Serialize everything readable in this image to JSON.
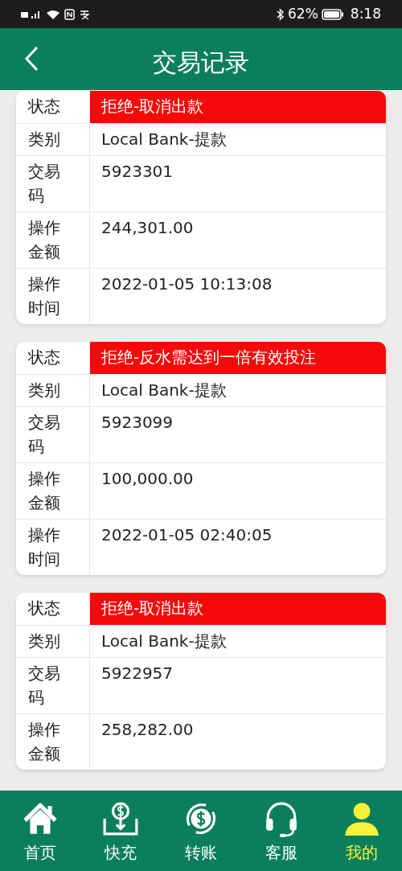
{
  "status_bar": {
    "battery_percent": "62%",
    "time": "8:18"
  },
  "header": {
    "title": "交易记录"
  },
  "records": [
    {
      "rows": [
        {
          "label": "状态",
          "value": "拒绝-取消出款",
          "kind": "status"
        },
        {
          "label": "类别",
          "value": "Local Bank-提款",
          "kind": "short"
        },
        {
          "label": "交易码",
          "value": "5923301",
          "kind": "tall"
        },
        {
          "label": "操作金额",
          "value": "244,301.00",
          "kind": "tall"
        },
        {
          "label": "操作时间",
          "value": "2022-01-05 10:13:08",
          "kind": "tall"
        }
      ]
    },
    {
      "rows": [
        {
          "label": "状态",
          "value": "拒绝-反水需达到一倍有效投注",
          "kind": "status"
        },
        {
          "label": "类别",
          "value": "Local Bank-提款",
          "kind": "short"
        },
        {
          "label": "交易码",
          "value": "5923099",
          "kind": "tall"
        },
        {
          "label": "操作金额",
          "value": "100,000.00",
          "kind": "tall"
        },
        {
          "label": "操作时间",
          "value": "2022-01-05 02:40:05",
          "kind": "tall"
        }
      ]
    },
    {
      "rows": [
        {
          "label": "状态",
          "value": "拒绝-取消出款",
          "kind": "status"
        },
        {
          "label": "类别",
          "value": "Local Bank-提款",
          "kind": "short"
        },
        {
          "label": "交易码",
          "value": "5922957",
          "kind": "tall"
        },
        {
          "label": "操作金额",
          "value": "258,282.00",
          "kind": "tall"
        }
      ]
    }
  ],
  "bottom_nav": [
    {
      "label": "首页",
      "selected": false
    },
    {
      "label": "快充",
      "selected": false
    },
    {
      "label": "转账",
      "selected": false
    },
    {
      "label": "客服",
      "selected": false
    },
    {
      "label": "我的",
      "selected": true
    }
  ]
}
